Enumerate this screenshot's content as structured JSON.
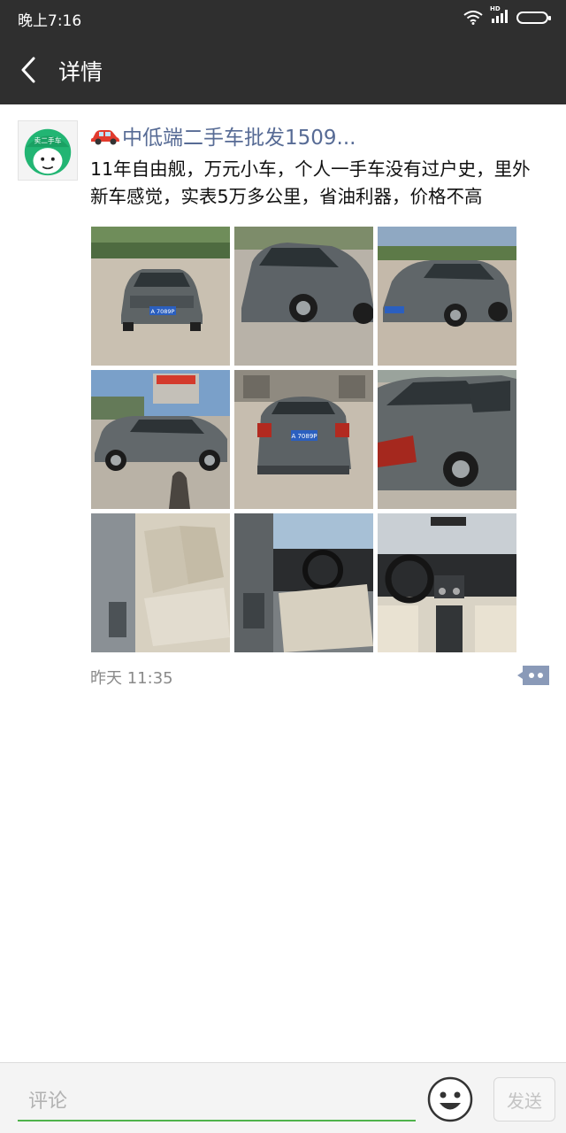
{
  "status_bar": {
    "time": "晚上7:16",
    "network_label": "HD"
  },
  "nav": {
    "title": "详情"
  },
  "post": {
    "author": "中低端二手车批发1509...",
    "text": "11年自由舰，万元小车，个人一手车没有过户史，里外新车感觉，实表5万多公里，省油利器，价格不高",
    "avatar_caption": "卖二手车",
    "timestamp": "昨天 11:35",
    "photos": [
      {
        "name": "front-view",
        "plate": "A 7089P"
      },
      {
        "name": "front-side-view",
        "plate": ""
      },
      {
        "name": "front-right-view",
        "plate": ""
      },
      {
        "name": "left-side-view",
        "plate": ""
      },
      {
        "name": "rear-view",
        "plate": "A 7089P"
      },
      {
        "name": "rear-right-view",
        "plate": ""
      },
      {
        "name": "rear-seat-interior",
        "plate": ""
      },
      {
        "name": "driver-door-interior",
        "plate": ""
      },
      {
        "name": "dashboard-interior",
        "plate": ""
      }
    ]
  },
  "comment_bar": {
    "placeholder": "评论",
    "send_label": "发送"
  },
  "colors": {
    "nav_bg": "#2f2f2f",
    "link": "#576b95",
    "accent_green": "#4fb34b"
  }
}
